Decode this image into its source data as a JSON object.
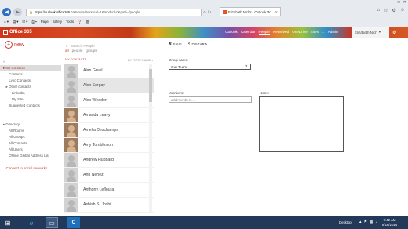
{
  "browser": {
    "url_highlight": "https://outlook.office365.com",
    "url_rest": "/owa/?exsvurl=1&modurl=0&path=/people",
    "tab_title": "Elizabeth Nichs - Outlook W...",
    "menu": [
      "Page",
      "Safety",
      "Tools"
    ]
  },
  "o365": {
    "brand": "Office 365",
    "nav": [
      "Outlook",
      "Calendar",
      "People",
      "Newsfeed",
      "OneDrive",
      "Sites",
      "...",
      "Admin"
    ],
    "active_nav": "People",
    "user": "Elizabeth Nich",
    "accent": "#c0392b"
  },
  "left_nav": {
    "new_label": "new",
    "items": [
      {
        "label": "«",
        "cls": "hdr"
      },
      {
        "label": "▸ My Contacts",
        "cls": "sel accent"
      },
      {
        "label": "      Contacts",
        "cls": ""
      },
      {
        "label": "      Lync Contacts",
        "cls": ""
      },
      {
        "label": "   ▸ Other contacts",
        "cls": ""
      },
      {
        "label": "         LinkedIn",
        "cls": ""
      },
      {
        "label": "         My Site",
        "cls": ""
      },
      {
        "label": "      Suggested Contacts",
        "cls": ""
      },
      {
        "label": "",
        "cls": ""
      },
      {
        "label": "",
        "cls": ""
      },
      {
        "label": "▸ Directory",
        "cls": ""
      },
      {
        "label": "      All Rooms",
        "cls": ""
      },
      {
        "label": "      All Groups",
        "cls": ""
      },
      {
        "label": "      All Contacts",
        "cls": ""
      },
      {
        "label": "      All Users",
        "cls": ""
      },
      {
        "label": "      Offline Global Address List",
        "cls": ""
      },
      {
        "label": "",
        "cls": ""
      },
      {
        "label": "   Connect to social networks",
        "cls": "accent"
      }
    ]
  },
  "list": {
    "search_placeholder": "Search People",
    "filters": [
      "all",
      "people",
      "groups"
    ],
    "header_left": "MY CONTACTS",
    "header_right": "BY FIRST NAME ▾",
    "contacts": [
      {
        "name": "Alan Gruel",
        "photo": false,
        "selected": false
      },
      {
        "name": "Alex Sergay",
        "photo": false,
        "selected": true
      },
      {
        "name": "Alex Weddon",
        "photo": false,
        "selected": false
      },
      {
        "name": "Amanda Leavy",
        "photo": true,
        "selected": false
      },
      {
        "name": "Amelia Deschamps",
        "photo": true,
        "selected": false
      },
      {
        "name": "Amy Tomblinson",
        "photo": true,
        "selected": false
      },
      {
        "name": "Andrew Hubbard",
        "photo": false,
        "selected": false
      },
      {
        "name": "Ann Nehez",
        "photo": false,
        "selected": false
      },
      {
        "name": "Anthony Lefloura",
        "photo": false,
        "selected": false
      },
      {
        "name": "Ashish S. Joshi",
        "photo": false,
        "selected": false
      }
    ]
  },
  "form": {
    "save": "SAVE",
    "discard": "DISCARD",
    "group_name_label": "Group name:",
    "group_name_value": "Our Team",
    "members_label": "Members:",
    "members_placeholder": "add members...",
    "notes_label": "Notes:"
  },
  "taskbar": {
    "desktop": "Desktop",
    "time": "9:42 AM",
    "date": "6/16/2014"
  }
}
